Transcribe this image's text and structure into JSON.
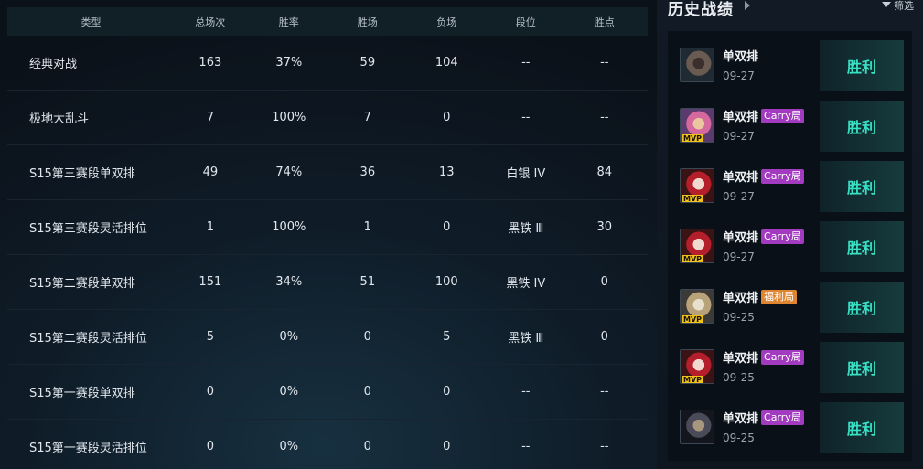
{
  "table": {
    "headers": [
      "类型",
      "总场次",
      "胜率",
      "胜场",
      "负场",
      "段位",
      "胜点"
    ],
    "rows": [
      [
        "经典对战",
        "163",
        "37%",
        "59",
        "104",
        "--",
        "--"
      ],
      [
        "极地大乱斗",
        "7",
        "100%",
        "7",
        "0",
        "--",
        "--"
      ],
      [
        "S15第三赛段单双排",
        "49",
        "74%",
        "36",
        "13",
        "白银 IV",
        "84"
      ],
      [
        "S15第三赛段灵活排位",
        "1",
        "100%",
        "1",
        "0",
        "黑铁 Ⅲ",
        "30"
      ],
      [
        "S15第二赛段单双排",
        "151",
        "34%",
        "51",
        "100",
        "黑铁 IV",
        "0"
      ],
      [
        "S15第二赛段灵活排位",
        "5",
        "0%",
        "0",
        "5",
        "黑铁 Ⅲ",
        "0"
      ],
      [
        "S15第一赛段单双排",
        "0",
        "0%",
        "0",
        "0",
        "--",
        "--"
      ],
      [
        "S15第一赛段灵活排位",
        "0",
        "0%",
        "0",
        "0",
        "--",
        "--"
      ]
    ]
  },
  "history": {
    "title": "历史战绩",
    "filter_label": "筛选",
    "matches": [
      {
        "mode": "单双排",
        "tag": "",
        "date": "09-27",
        "result": "胜利",
        "mvp": false,
        "champ_icon": "champion-portrait-dark-hair",
        "palette": [
          "#1f2a33",
          "#6a5b52",
          "#3a2f2c"
        ]
      },
      {
        "mode": "单双排",
        "tag": "Carry局",
        "tag_color": "#a23bbf",
        "date": "09-27",
        "result": "胜利",
        "mvp": true,
        "champ_icon": "champion-portrait-pink-hair",
        "palette": [
          "#5b3a6e",
          "#d5689c",
          "#e9c6a0"
        ]
      },
      {
        "mode": "单双排",
        "tag": "Carry局",
        "tag_color": "#a23bbf",
        "date": "09-27",
        "result": "胜利",
        "mvp": true,
        "champ_icon": "champion-portrait-red-hair",
        "palette": [
          "#3a1414",
          "#b51f2b",
          "#f1d9cf"
        ]
      },
      {
        "mode": "单双排",
        "tag": "Carry局",
        "tag_color": "#a23bbf",
        "date": "09-27",
        "result": "胜利",
        "mvp": true,
        "champ_icon": "champion-portrait-red-hair",
        "palette": [
          "#3a1414",
          "#b51f2b",
          "#f1d9cf"
        ]
      },
      {
        "mode": "单双排",
        "tag": "福利局",
        "tag_color": "#e0852f",
        "date": "09-25",
        "result": "胜利",
        "mvp": true,
        "champ_icon": "champion-portrait-armored",
        "palette": [
          "#3b3a36",
          "#b7a27a",
          "#e8e0cd"
        ]
      },
      {
        "mode": "单双排",
        "tag": "Carry局",
        "tag_color": "#a23bbf",
        "date": "09-25",
        "result": "胜利",
        "mvp": true,
        "champ_icon": "champion-portrait-red-hair",
        "palette": [
          "#3a1414",
          "#b51f2b",
          "#f1d9cf"
        ]
      },
      {
        "mode": "单双排",
        "tag": "Carry局",
        "tag_color": "#a23bbf",
        "date": "09-25",
        "result": "胜利",
        "mvp": false,
        "champ_icon": "champion-portrait-dark-warrior",
        "palette": [
          "#14161d",
          "#4b4a58",
          "#a8977f"
        ]
      }
    ],
    "mvp_label": "MVP"
  },
  "colors": {
    "win": "#38e0c4",
    "background": "#0b1119",
    "header_bg": "#111f27"
  }
}
